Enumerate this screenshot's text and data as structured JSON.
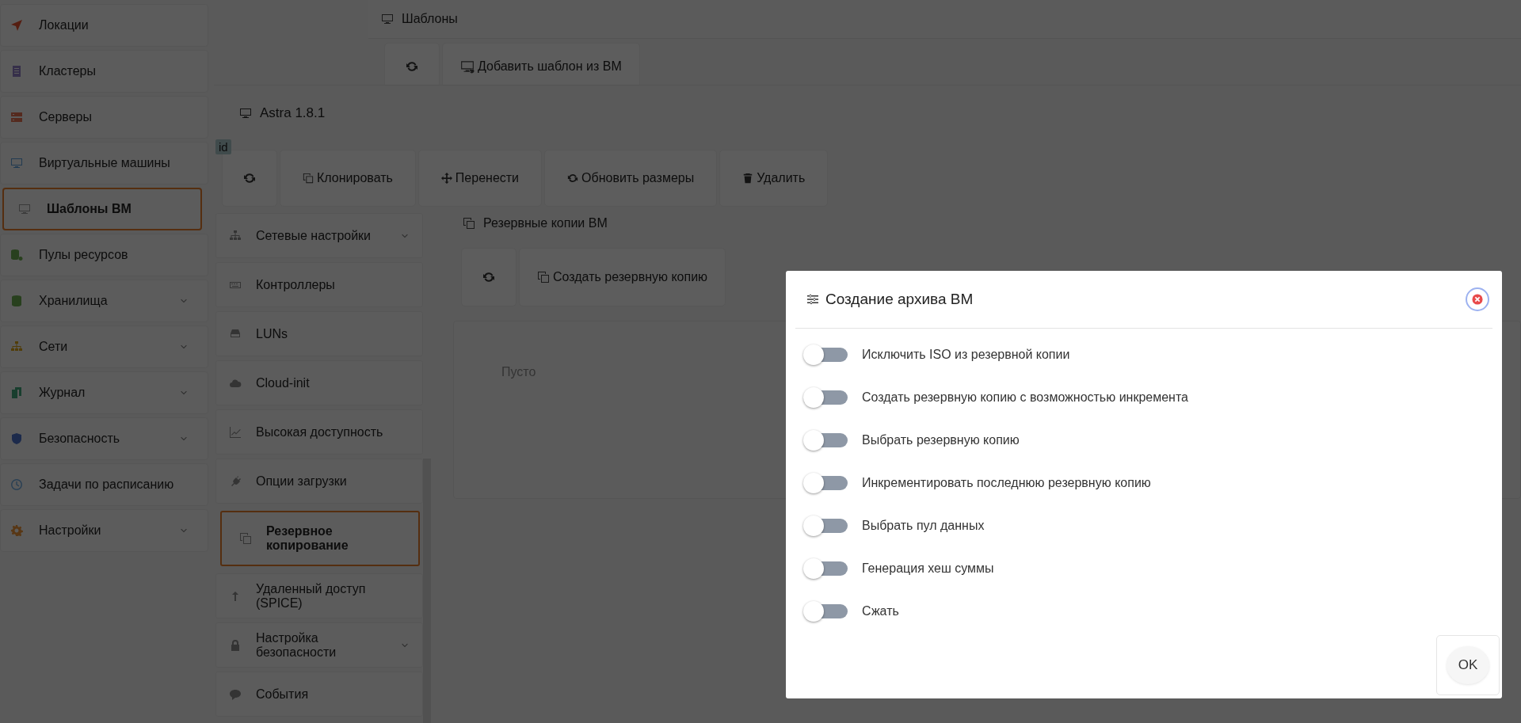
{
  "sidebar": {
    "items": [
      {
        "label": "Локации",
        "selected": false,
        "has_submenu": false
      },
      {
        "label": "Кластеры",
        "selected": false,
        "has_submenu": false
      },
      {
        "label": "Серверы",
        "selected": false,
        "has_submenu": false
      },
      {
        "label": "Виртуальные машины",
        "selected": false,
        "has_submenu": false
      },
      {
        "label": "Шаблоны ВМ",
        "selected": true,
        "has_submenu": false
      },
      {
        "label": "Пулы ресурсов",
        "selected": false,
        "has_submenu": false
      },
      {
        "label": "Хранилища",
        "selected": false,
        "has_submenu": true
      },
      {
        "label": "Сети",
        "selected": false,
        "has_submenu": true
      },
      {
        "label": "Журнал",
        "selected": false,
        "has_submenu": true
      },
      {
        "label": "Безопасность",
        "selected": false,
        "has_submenu": true
      },
      {
        "label": "Задачи по расписанию",
        "selected": false,
        "has_submenu": false
      },
      {
        "label": "Настройки",
        "selected": false,
        "has_submenu": true
      }
    ]
  },
  "page": {
    "title": "Шаблоны",
    "toolbar": [
      "Добавить шаблон из ВМ"
    ]
  },
  "vm_window": {
    "title": "Astra 1.8.1",
    "badge": "id",
    "toolbar": [
      "Клонировать",
      "Перенести",
      "Обновить размеры",
      "Удалить"
    ],
    "nav": [
      {
        "label": "Сетевые настройки",
        "selected": false,
        "has_submenu": true
      },
      {
        "label": "Контроллеры",
        "selected": false,
        "has_submenu": false
      },
      {
        "label": "LUNs",
        "selected": false,
        "has_submenu": false
      },
      {
        "label": "Cloud-init",
        "selected": false,
        "has_submenu": false
      },
      {
        "label": "Высокая доступность",
        "selected": false,
        "has_submenu": false
      },
      {
        "label": "Опции загрузки",
        "selected": false,
        "has_submenu": false
      },
      {
        "label": "Резервное копирование",
        "selected": true,
        "has_submenu": false
      },
      {
        "label": "Удаленный доступ (SPICE)",
        "selected": false,
        "has_submenu": false
      },
      {
        "label": "Настройка безопасности",
        "selected": false,
        "has_submenu": true
      },
      {
        "label": "События",
        "selected": false,
        "has_submenu": false
      }
    ],
    "section": {
      "title": "Резервные копии ВМ",
      "toolbar": [
        "Создать резервную копию"
      ],
      "empty_text": "Пусто"
    }
  },
  "dialog": {
    "title": "Создание архива ВМ",
    "options": [
      {
        "label": "Исключить ISO из резервной копии",
        "on": false
      },
      {
        "label": "Создать резервную копию с возможностью инкремента",
        "on": false
      },
      {
        "label": "Выбрать резервную копию",
        "on": false
      },
      {
        "label": "Инкрементировать последнюю резервную копию",
        "on": false
      },
      {
        "label": "Выбрать пул данных",
        "on": false
      },
      {
        "label": "Генерация хеш суммы",
        "on": false
      },
      {
        "label": "Сжать",
        "on": false
      }
    ],
    "ok_button": "OK"
  }
}
